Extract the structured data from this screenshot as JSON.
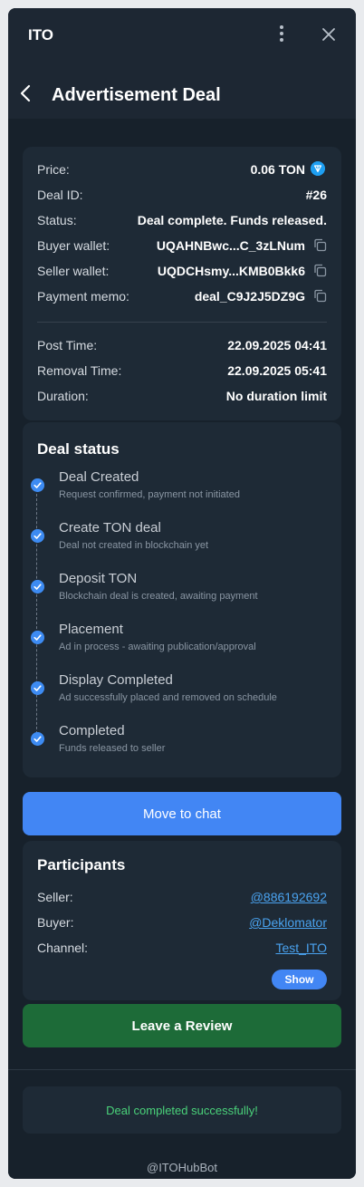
{
  "app": {
    "title": "ITO"
  },
  "header": {
    "title": "Advertisement Deal"
  },
  "deal": {
    "price_label": "Price:",
    "price_value": "0.06 TON",
    "id_label": "Deal ID:",
    "id_value": "#26",
    "status_label": "Status:",
    "status_value": "Deal complete. Funds released.",
    "buyer_wallet_label": "Buyer wallet:",
    "buyer_wallet_value": "UQAHNBwc...C_3zLNum",
    "seller_wallet_label": "Seller wallet:",
    "seller_wallet_value": "UQDCHsmy...KMB0Bkk6",
    "memo_label": "Payment memo:",
    "memo_value": "deal_C9J2J5DZ9G",
    "post_time_label": "Post Time:",
    "post_time_value": "22.09.2025 04:41",
    "removal_time_label": "Removal Time:",
    "removal_time_value": "22.09.2025 05:41",
    "duration_label": "Duration:",
    "duration_value": "No duration limit"
  },
  "deal_status": {
    "title": "Deal status",
    "steps": [
      {
        "title": "Deal Created",
        "subtitle": "Request confirmed, payment not initiated"
      },
      {
        "title": "Create TON deal",
        "subtitle": "Deal not created in blockchain yet"
      },
      {
        "title": "Deposit TON",
        "subtitle": "Blockchain deal is created, awaiting payment"
      },
      {
        "title": "Placement",
        "subtitle": "Ad in process - awaiting publication/approval"
      },
      {
        "title": "Display Completed",
        "subtitle": "Ad successfully placed and removed on schedule"
      },
      {
        "title": "Completed",
        "subtitle": "Funds released to seller"
      }
    ]
  },
  "actions": {
    "move_to_chat": "Move to chat",
    "leave_review": "Leave a Review"
  },
  "participants": {
    "title": "Participants",
    "seller_label": "Seller:",
    "seller_value": "@886192692",
    "buyer_label": "Buyer:",
    "buyer_value": "@Deklomator",
    "channel_label": "Channel:",
    "channel_value": "Test_ITO",
    "show_label": "Show"
  },
  "success": {
    "message": "Deal completed successfully!"
  },
  "footer": {
    "bot": "@ITOHubBot"
  },
  "colors": {
    "accent": "#4286f4",
    "success": "#4ad27a",
    "review": "#1d6b38"
  }
}
